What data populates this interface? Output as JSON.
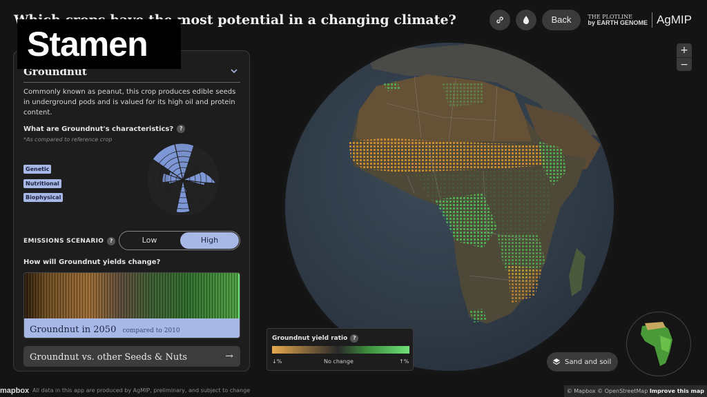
{
  "header": {
    "title": "Which crops have the most potential in a changing climate?",
    "overlay_logo": "Stamen",
    "back_label": "Back",
    "plotline_top": "THE PLOTLINE",
    "plotline_bottom": "EARTH GENOME",
    "plotline_by": "by",
    "agmip": "AgMIP"
  },
  "panel": {
    "crop_name": "Groundnut",
    "description": "Commonly known as peanut, this crop produces edible seeds in underground pods and is valued for its high oil and protein content.",
    "characteristics_question": "What are Groundnut's characteristics?",
    "characteristics_note": "*As compared to reference crop",
    "tags": [
      "Genetic",
      "Nutritional",
      "Biophysical"
    ],
    "emissions_label": "EMISSIONS SCENARIO",
    "scenario_options": [
      "Low",
      "High"
    ],
    "scenario_selected": "High",
    "yield_question": "How will Groundnut yields change?",
    "yield_footer_main": "Groundnut in 2050",
    "yield_footer_sub": "compared to 2010",
    "compare_label": "Groundnut vs. other Seeds & Nuts",
    "compare_arrow": "→"
  },
  "legend": {
    "title": "Groundnut yield ratio",
    "left": "↓%",
    "center": "No change",
    "right": "↑%"
  },
  "map": {
    "zoom_in": "+",
    "zoom_out": "−",
    "layer_button": "Sand and soil"
  },
  "footer": {
    "mapbox": "mapbox",
    "note": "All data in this app are produced by AgMIP, preliminary, and subject to change",
    "attribution": "© Mapbox © OpenStreetMap",
    "improve": "Improve this map"
  },
  "colors": {
    "accent": "#a8b8e6",
    "decline": "#e7a94d",
    "increase": "#6fe07a"
  }
}
